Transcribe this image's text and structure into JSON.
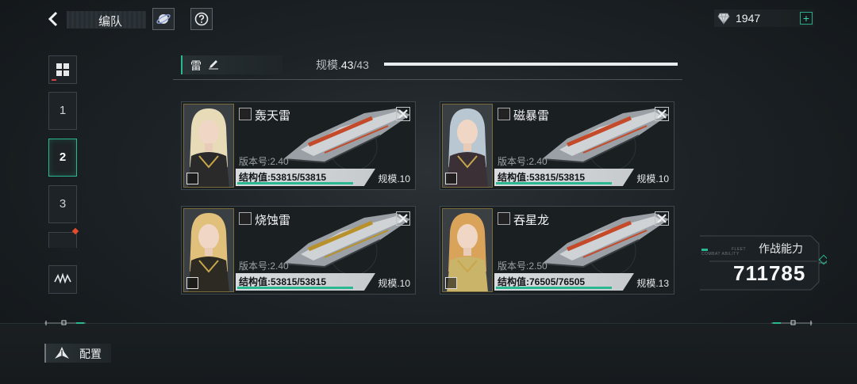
{
  "header": {
    "title": "编队",
    "currency_value": "1947",
    "plus_label": "+"
  },
  "side_tabs": [
    {
      "label": "1"
    },
    {
      "label": "2",
      "active": true
    },
    {
      "label": "3"
    }
  ],
  "fleet": {
    "name": "雷",
    "scale_label": "规模.",
    "scale_current": "43",
    "scale_max": "/43",
    "scale_fill": 1.0
  },
  "ships": [
    {
      "name": "轰天雷",
      "version": "版本号:2.40",
      "hp": "结构值:53815/53815",
      "scale": "规模.10",
      "hp_fraction": 1.0,
      "accent": "#c44a2a"
    },
    {
      "name": "磁暴雷",
      "version": "版本号:2.40",
      "hp": "结构值:53815/53815",
      "scale": "规模.10",
      "hp_fraction": 1.0,
      "accent": "#c44a2a"
    },
    {
      "name": "烧蚀雷",
      "version": "版本号:2.40",
      "hp": "结构值:53815/53815",
      "scale": "规模.10",
      "hp_fraction": 1.0,
      "accent": "#b8912a"
    },
    {
      "name": "吞星龙",
      "version": "版本号:2.50",
      "hp": "结构值:76505/76505",
      "scale": "规模.13",
      "hp_fraction": 1.0,
      "accent": "#c44a2a"
    }
  ],
  "power": {
    "label": "作战能力",
    "value": "711785",
    "tag_line1": "FLEET",
    "tag_line2": "COMBAT ABILITY"
  },
  "bottom": {
    "config_label": "配置"
  },
  "colors": {
    "accent_green": "#29b892",
    "bg_dark": "#1a1f22"
  }
}
